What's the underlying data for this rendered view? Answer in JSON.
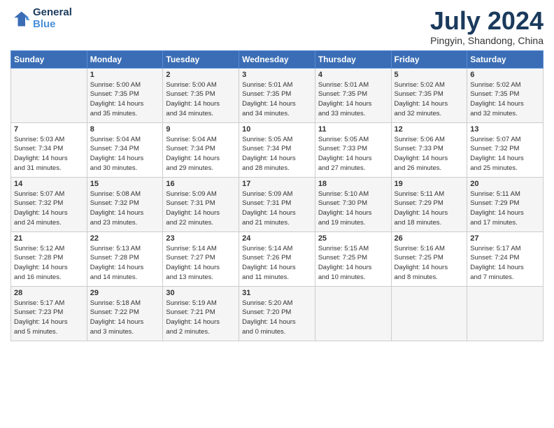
{
  "header": {
    "logo_line1": "General",
    "logo_line2": "Blue",
    "month": "July 2024",
    "location": "Pingyin, Shandong, China"
  },
  "weekdays": [
    "Sunday",
    "Monday",
    "Tuesday",
    "Wednesday",
    "Thursday",
    "Friday",
    "Saturday"
  ],
  "weeks": [
    [
      {
        "day": "",
        "info": ""
      },
      {
        "day": "1",
        "info": "Sunrise: 5:00 AM\nSunset: 7:35 PM\nDaylight: 14 hours\nand 35 minutes."
      },
      {
        "day": "2",
        "info": "Sunrise: 5:00 AM\nSunset: 7:35 PM\nDaylight: 14 hours\nand 34 minutes."
      },
      {
        "day": "3",
        "info": "Sunrise: 5:01 AM\nSunset: 7:35 PM\nDaylight: 14 hours\nand 34 minutes."
      },
      {
        "day": "4",
        "info": "Sunrise: 5:01 AM\nSunset: 7:35 PM\nDaylight: 14 hours\nand 33 minutes."
      },
      {
        "day": "5",
        "info": "Sunrise: 5:02 AM\nSunset: 7:35 PM\nDaylight: 14 hours\nand 32 minutes."
      },
      {
        "day": "6",
        "info": "Sunrise: 5:02 AM\nSunset: 7:35 PM\nDaylight: 14 hours\nand 32 minutes."
      }
    ],
    [
      {
        "day": "7",
        "info": "Sunrise: 5:03 AM\nSunset: 7:34 PM\nDaylight: 14 hours\nand 31 minutes."
      },
      {
        "day": "8",
        "info": "Sunrise: 5:04 AM\nSunset: 7:34 PM\nDaylight: 14 hours\nand 30 minutes."
      },
      {
        "day": "9",
        "info": "Sunrise: 5:04 AM\nSunset: 7:34 PM\nDaylight: 14 hours\nand 29 minutes."
      },
      {
        "day": "10",
        "info": "Sunrise: 5:05 AM\nSunset: 7:34 PM\nDaylight: 14 hours\nand 28 minutes."
      },
      {
        "day": "11",
        "info": "Sunrise: 5:05 AM\nSunset: 7:33 PM\nDaylight: 14 hours\nand 27 minutes."
      },
      {
        "day": "12",
        "info": "Sunrise: 5:06 AM\nSunset: 7:33 PM\nDaylight: 14 hours\nand 26 minutes."
      },
      {
        "day": "13",
        "info": "Sunrise: 5:07 AM\nSunset: 7:32 PM\nDaylight: 14 hours\nand 25 minutes."
      }
    ],
    [
      {
        "day": "14",
        "info": "Sunrise: 5:07 AM\nSunset: 7:32 PM\nDaylight: 14 hours\nand 24 minutes."
      },
      {
        "day": "15",
        "info": "Sunrise: 5:08 AM\nSunset: 7:32 PM\nDaylight: 14 hours\nand 23 minutes."
      },
      {
        "day": "16",
        "info": "Sunrise: 5:09 AM\nSunset: 7:31 PM\nDaylight: 14 hours\nand 22 minutes."
      },
      {
        "day": "17",
        "info": "Sunrise: 5:09 AM\nSunset: 7:31 PM\nDaylight: 14 hours\nand 21 minutes."
      },
      {
        "day": "18",
        "info": "Sunrise: 5:10 AM\nSunset: 7:30 PM\nDaylight: 14 hours\nand 19 minutes."
      },
      {
        "day": "19",
        "info": "Sunrise: 5:11 AM\nSunset: 7:29 PM\nDaylight: 14 hours\nand 18 minutes."
      },
      {
        "day": "20",
        "info": "Sunrise: 5:11 AM\nSunset: 7:29 PM\nDaylight: 14 hours\nand 17 minutes."
      }
    ],
    [
      {
        "day": "21",
        "info": "Sunrise: 5:12 AM\nSunset: 7:28 PM\nDaylight: 14 hours\nand 16 minutes."
      },
      {
        "day": "22",
        "info": "Sunrise: 5:13 AM\nSunset: 7:28 PM\nDaylight: 14 hours\nand 14 minutes."
      },
      {
        "day": "23",
        "info": "Sunrise: 5:14 AM\nSunset: 7:27 PM\nDaylight: 14 hours\nand 13 minutes."
      },
      {
        "day": "24",
        "info": "Sunrise: 5:14 AM\nSunset: 7:26 PM\nDaylight: 14 hours\nand 11 minutes."
      },
      {
        "day": "25",
        "info": "Sunrise: 5:15 AM\nSunset: 7:25 PM\nDaylight: 14 hours\nand 10 minutes."
      },
      {
        "day": "26",
        "info": "Sunrise: 5:16 AM\nSunset: 7:25 PM\nDaylight: 14 hours\nand 8 minutes."
      },
      {
        "day": "27",
        "info": "Sunrise: 5:17 AM\nSunset: 7:24 PM\nDaylight: 14 hours\nand 7 minutes."
      }
    ],
    [
      {
        "day": "28",
        "info": "Sunrise: 5:17 AM\nSunset: 7:23 PM\nDaylight: 14 hours\nand 5 minutes."
      },
      {
        "day": "29",
        "info": "Sunrise: 5:18 AM\nSunset: 7:22 PM\nDaylight: 14 hours\nand 3 minutes."
      },
      {
        "day": "30",
        "info": "Sunrise: 5:19 AM\nSunset: 7:21 PM\nDaylight: 14 hours\nand 2 minutes."
      },
      {
        "day": "31",
        "info": "Sunrise: 5:20 AM\nSunset: 7:20 PM\nDaylight: 14 hours\nand 0 minutes."
      },
      {
        "day": "",
        "info": ""
      },
      {
        "day": "",
        "info": ""
      },
      {
        "day": "",
        "info": ""
      }
    ]
  ]
}
